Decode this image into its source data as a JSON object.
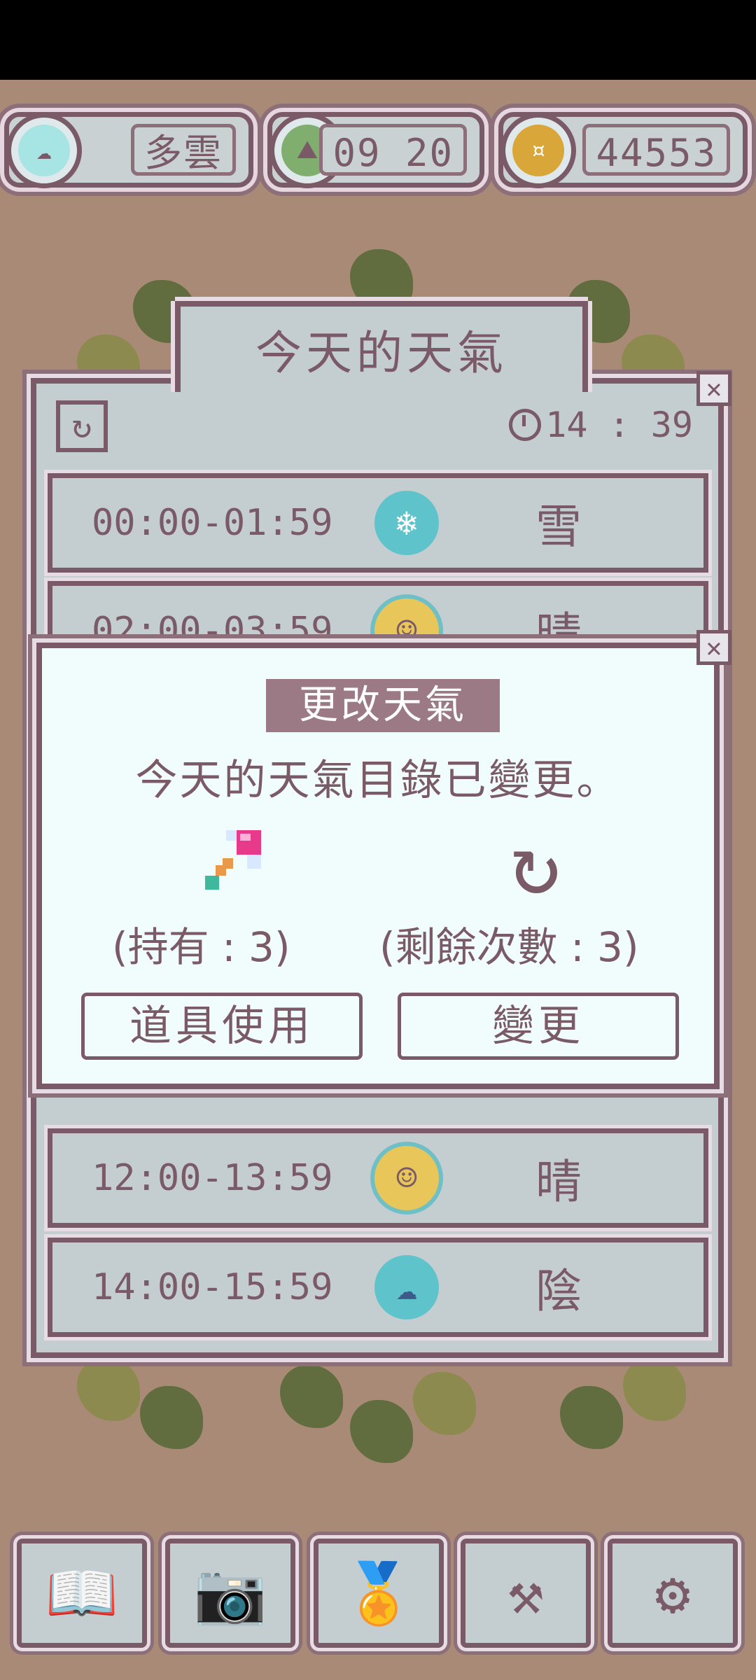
{
  "hud": {
    "weather_label": "多雲",
    "date_label": "09 20",
    "coins_label": "44553"
  },
  "panel": {
    "title": "今天的天氣",
    "current_time": "14 : 39",
    "rows": [
      {
        "time": "00:00-01:59",
        "weather": "雪",
        "icon": "snowflake-icon"
      },
      {
        "time": "02:00-03:59",
        "weather": "晴",
        "icon": "sun-icon"
      },
      {
        "time": "12:00-13:59",
        "weather": "晴",
        "icon": "sun-icon"
      },
      {
        "time": "14:00-15:59",
        "weather": "陰",
        "icon": "cloud-icon"
      }
    ]
  },
  "dialog": {
    "title": "更改天氣",
    "message": "今天的天氣目錄已變更。",
    "owned_count": "(持有 : 3)",
    "remaining_count": "(剩餘次數 : 3)",
    "use_item_label": "道具使用",
    "change_label": "變更"
  },
  "colors": {
    "background": "#a98a76",
    "panel": "#c4ced0",
    "border": "#7a5a66",
    "dialog_bg": "#f1fdfd",
    "title_bg": "#9b7a85"
  }
}
